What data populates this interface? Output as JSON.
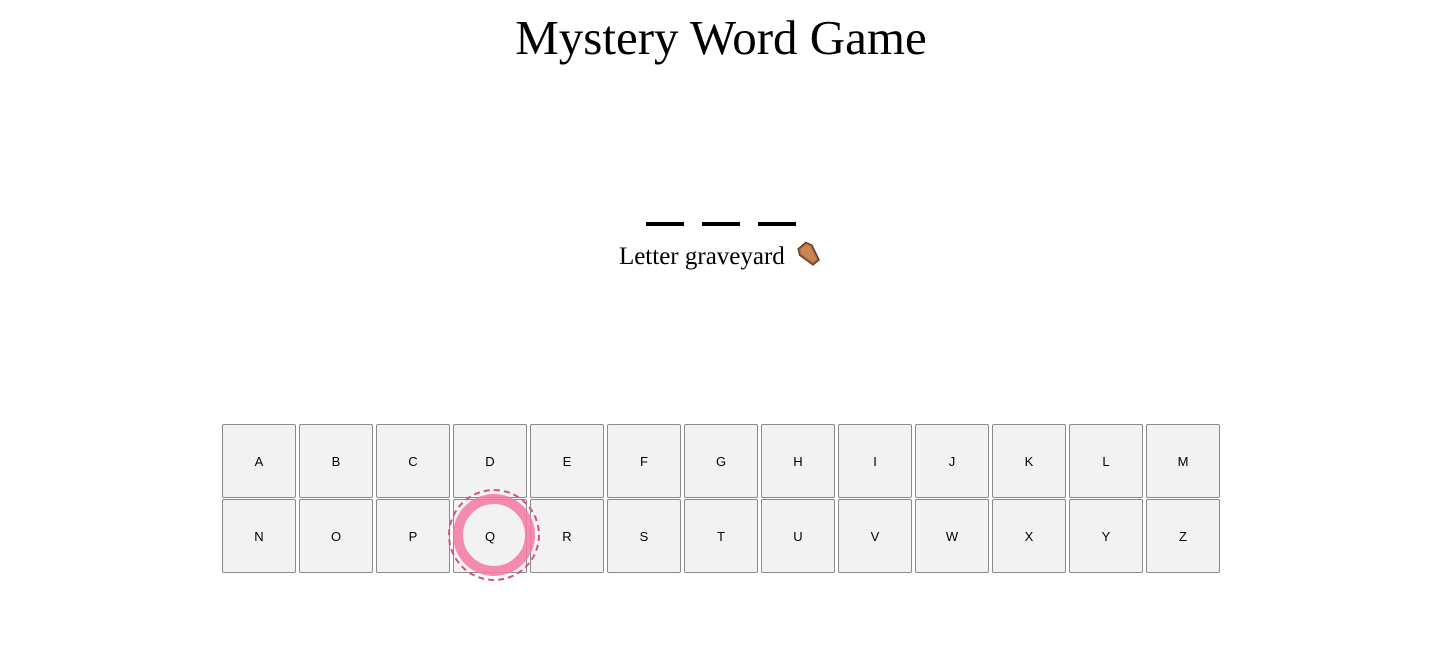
{
  "title": "Mystery Word Game",
  "word": {
    "slots": [
      "",
      "",
      ""
    ]
  },
  "graveyard": {
    "label": "Letter graveyard",
    "icon": "coffin-icon"
  },
  "keyboard": {
    "rows": [
      [
        "A",
        "B",
        "C",
        "D",
        "E",
        "F",
        "G",
        "H",
        "I",
        "J",
        "K",
        "L",
        "M"
      ],
      [
        "N",
        "O",
        "P",
        "Q",
        "R",
        "S",
        "T",
        "U",
        "V",
        "W",
        "X",
        "Y",
        "Z"
      ]
    ]
  },
  "click_indicator": {
    "target_key": "Q",
    "color": "#f478a0"
  }
}
